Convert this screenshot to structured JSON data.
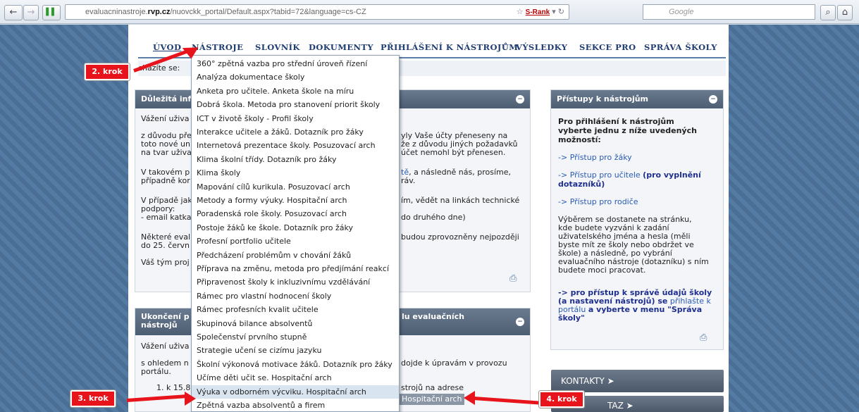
{
  "browser": {
    "url_prefix": "evaluacninastroje.",
    "url_domain": "rvp.cz",
    "url_suffix": "/nuovckk_portal/Default.aspx?tabid=72&language=cs-CZ",
    "srank": "S-Rank",
    "search_placeholder": "Google"
  },
  "nav": {
    "uvod": "ÚVOD",
    "nastroje": "NÁSTROJE",
    "slovnik": "SLOVNÍK",
    "dokumenty": "DOKUMENTY",
    "prihlaseni": "PŘIHLÁŠENÍ K NÁSTROJŮM",
    "vysledky": "VÝSLEDKY",
    "sekce": "SEKCE PRO",
    "sprava": "SPRÁVA ŠKOLY"
  },
  "breadcrumb": "cházíte se:",
  "panel1": {
    "title": "Důležitá inf",
    "l1": "Vážení uživa",
    "l2a": "z důvodu pře",
    "l2b": "toto nové un",
    "l2c": "na tvar uživa",
    "r2a": "yly Vaše účty přeneseny na",
    "r2b": "že z důvodu jiných požadavků",
    "r2c": "účet nemohl být přenesen.",
    "l3a": "V takovém p",
    "l3b": "případně kor",
    "r3a_link": "tě",
    "r3a": ", a následně nás, prosíme,",
    "r3b": "ráv.",
    "l4a": "V případě jak",
    "l4b": "podpory:",
    "l4c": "- email katka",
    "r4a": "ím, vědět na linkách technické",
    "r4c": "do druhého dne)",
    "l5a": "Některé eval",
    "l5b": "do 25. červn",
    "r5a": "budou zprovozněny nejpozději",
    "l6": "Váš tým proj"
  },
  "panel2": {
    "title_a": "Ukončení p",
    "title_b": "nástrojů",
    "title_r": "lu evaluačních",
    "l1": "Vážení uživa",
    "l2a": "s ohledem n",
    "l2b": "portálu.",
    "r2a": "dojde k úpravám v provozu",
    "l3": "1.  k 15.8",
    "r3": "strojů na adrese",
    "r4": "Hospitační arch"
  },
  "right_panel": {
    "title": "Přístupy k nástrojům",
    "intro1": "Pro přihlášení k nástrojům",
    "intro2": "vyberte jednu z níže uvedených",
    "intro3": "možností:",
    "arrow": "->",
    "link_zaky": "Přístup pro žáky",
    "link_ucitele": "Přístup pro učitele",
    "ucitele_note1": "(pro vyplnění",
    "ucitele_note2": "dotazníků)",
    "link_rodice": "Přístup pro rodiče",
    "desc1": "Výběrem se dostanete na stránku,",
    "desc2": "kde budete vyzváni k zadání",
    "desc3": "uživatelského jména a hesla (měli",
    "desc4": "byste mít ze školy nebo obdržet ve",
    "desc5": "škole) a následně, po vybrání",
    "desc6": "evaluačního nástroje (dotazníku) s ním",
    "desc7": "budete moci pracovat.",
    "admin1": "-> pro přístup k správě údajů školy",
    "admin2a": "(a nastavení nástrojů) se",
    "admin2b": "přihlašte k",
    "admin3a": "portálu",
    "admin3b": "a vyberte v menu \"Správa",
    "admin4": "školy\""
  },
  "side_buttons": {
    "kontakty": "KONTAKTY",
    "second": "TAZ"
  },
  "dropdown_items": [
    "360° zpětná vazba pro střední úroveň řízení",
    "Analýza dokumentace školy",
    "Anketa pro učitele. Anketa škole na míru",
    "Dobrá škola. Metoda pro stanovení priorit školy",
    "ICT v životě školy - Profil školy",
    "Interakce učitele a žáků. Dotazník pro žáky",
    "Internetová prezentace školy. Posuzovací arch",
    "Klima školní třídy. Dotazník pro žáky",
    "Klima školy",
    "Mapování cílů kurikula. Posuzovací arch",
    "Metody a formy výuky. Hospitační arch",
    "Poradenská role školy. Posuzovací arch",
    "Postoje žáků ke škole. Dotazník pro žáky",
    "Profesní portfolio učitele",
    "Předcházení problémům v chování žáků",
    "Příprava na změnu, metoda pro předjímání reakcí",
    "Připravenost školy k inkluzivnímu vzdělávání",
    "Rámec pro vlastní hodnocení školy",
    "Rámec profesních kvalit učitele",
    "Skupinová bilance absolventů",
    "Společenství prvního stupně",
    "Strategie učení se cizímu jazyku",
    "Školní výkonová motivace žáků. Dotazník pro žáky",
    "Učíme děti učit se. Hospitační arch",
    "Výuka v odborném výcviku. Hospitační arch",
    "Zpětná vazba absolventů a firem"
  ],
  "annotations": {
    "krok2": "2. krok",
    "krok3": "3. krok",
    "krok4": "4. krok"
  },
  "colors": {
    "annotation": "#e8141c",
    "nav_text": "#1f3d73",
    "panel_head": "#4d5d72"
  }
}
